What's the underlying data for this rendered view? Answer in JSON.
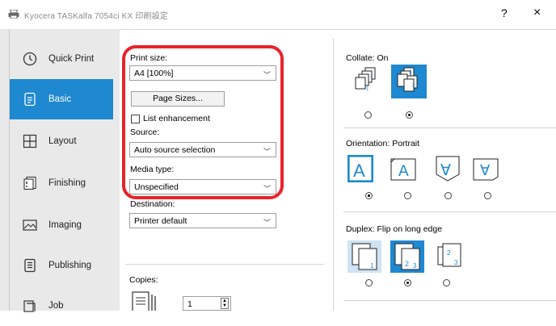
{
  "window": {
    "title": "Kyocera TASKalfa 7054ci KX 印刷設定",
    "help_label": "?",
    "close_label": "×"
  },
  "sidebar": {
    "items": [
      {
        "label": "Quick Print",
        "icon": "clock-icon"
      },
      {
        "label": "Basic",
        "icon": "document-icon",
        "active": true
      },
      {
        "label": "Layout",
        "icon": "grid-icon"
      },
      {
        "label": "Finishing",
        "icon": "finishing-icon"
      },
      {
        "label": "Imaging",
        "icon": "image-icon"
      },
      {
        "label": "Publishing",
        "icon": "publishing-icon"
      },
      {
        "label": "Job",
        "icon": "job-icon"
      }
    ]
  },
  "basic": {
    "print_size_label": "Print size:",
    "print_size_value": "A4  [100%]",
    "page_sizes_button": "Page Sizes...",
    "list_enhancement_label": "List enhancement",
    "source_label": "Source:",
    "source_value": "Auto source selection",
    "media_type_label": "Media type:",
    "media_type_value": "Unspecified",
    "destination_label": "Destination:",
    "destination_value": "Printer default",
    "copies_label": "Copies:",
    "copies_value": "1",
    "collate_label": "Collate:  On",
    "orientation_label": "Orientation:  Portrait",
    "orientation_glyphs": [
      "A",
      "A",
      "∀",
      "∀"
    ],
    "duplex_label": "Duplex:  Flip on long edge",
    "duplex_numbers": [
      "1",
      "2",
      "3"
    ]
  },
  "colors": {
    "accent": "#1e88d0",
    "highlight": "#e8232b",
    "sidebar_bg": "#e9e9e9"
  }
}
